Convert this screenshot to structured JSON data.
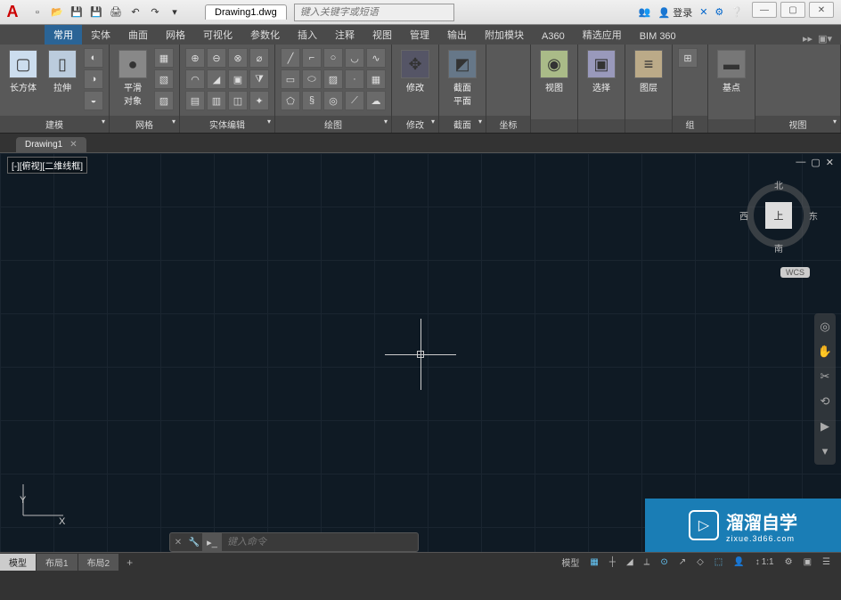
{
  "title": {
    "doc_name": "Drawing1.dwg",
    "search_placeholder": "键入关键字或短语",
    "login": "登录"
  },
  "qat_icons": [
    "new",
    "open",
    "save",
    "saveas",
    "print",
    "undo",
    "redo",
    "more"
  ],
  "window_controls": {
    "min": "—",
    "max": "▢",
    "close": "✕"
  },
  "ribbon_tabs": [
    "常用",
    "实体",
    "曲面",
    "网格",
    "可视化",
    "参数化",
    "插入",
    "注释",
    "视图",
    "管理",
    "输出",
    "附加模块",
    "A360",
    "精选应用",
    "BIM 360"
  ],
  "active_ribbon_tab": 0,
  "panels": {
    "modeling": {
      "label": "建模",
      "buttons": [
        {
          "label": "长方体",
          "name": "box-button"
        },
        {
          "label": "拉伸",
          "name": "extrude-button"
        }
      ]
    },
    "mesh": {
      "label": "网格",
      "button": {
        "label": "平滑\n对象",
        "name": "smooth-object-button"
      }
    },
    "solid_edit": {
      "label": "实体编辑"
    },
    "draw": {
      "label": "绘图"
    },
    "modify": {
      "label": "修改",
      "button": {
        "label": "修改",
        "name": "modify-button"
      }
    },
    "section": {
      "label": "截面",
      "button": {
        "label": "截面\n平面",
        "name": "section-plane-button"
      }
    },
    "coord": {
      "label": "坐标"
    },
    "view": {
      "label": "视图",
      "button": {
        "label": "视图",
        "name": "view-button"
      }
    },
    "select": {
      "label": "选择",
      "button": {
        "label": "选择",
        "name": "select-button"
      }
    },
    "layer": {
      "label": "图层",
      "button": {
        "label": "图层",
        "name": "layer-button"
      }
    },
    "group": {
      "label": "组"
    },
    "base": {
      "label": "基点",
      "button": {
        "label": "基点",
        "name": "base-button"
      }
    },
    "view_right": {
      "label": "视图"
    }
  },
  "file_tabs": [
    {
      "name": "Drawing1",
      "active": true
    }
  ],
  "viewport": {
    "label": "[-][俯视][二维线框]"
  },
  "viewcube": {
    "top": "上",
    "n": "北",
    "s": "南",
    "e": "东",
    "w": "西",
    "wcs": "WCS"
  },
  "ucs": {
    "x": "X",
    "y": "Y"
  },
  "command": {
    "placeholder": "键入命令"
  },
  "layout_tabs": [
    "模型",
    "布局1",
    "布局2"
  ],
  "active_layout": 0,
  "status": {
    "model": "模型",
    "scale": "1:1"
  },
  "watermark": {
    "main": "溜溜自学",
    "sub": "zixue.3d66.com"
  }
}
